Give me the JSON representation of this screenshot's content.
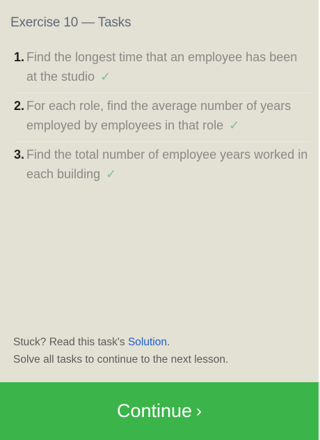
{
  "header": {
    "title": "Exercise 10 — Tasks"
  },
  "tasks": [
    {
      "number": "1.",
      "text": "Find the longest time that an employee has been at the studio",
      "check": "✓"
    },
    {
      "number": "2.",
      "text": "For each role, find the average number of years employed by employees in that role",
      "check": "✓"
    },
    {
      "number": "3.",
      "text": "Find the total number of employee years worked in each building",
      "check": "✓"
    }
  ],
  "footer": {
    "stuck_prefix": "Stuck? Read this task's ",
    "solution_link": "Solution",
    "stuck_suffix": ".",
    "note": "Solve all tasks to continue to the next lesson."
  },
  "continue_button": {
    "label": "Continue",
    "chevron": "›"
  },
  "colors": {
    "panel_bg": "#e3e0d4",
    "button_bg": "#3bb54a",
    "link": "#1d5fcf",
    "check": "#7cc48a"
  }
}
